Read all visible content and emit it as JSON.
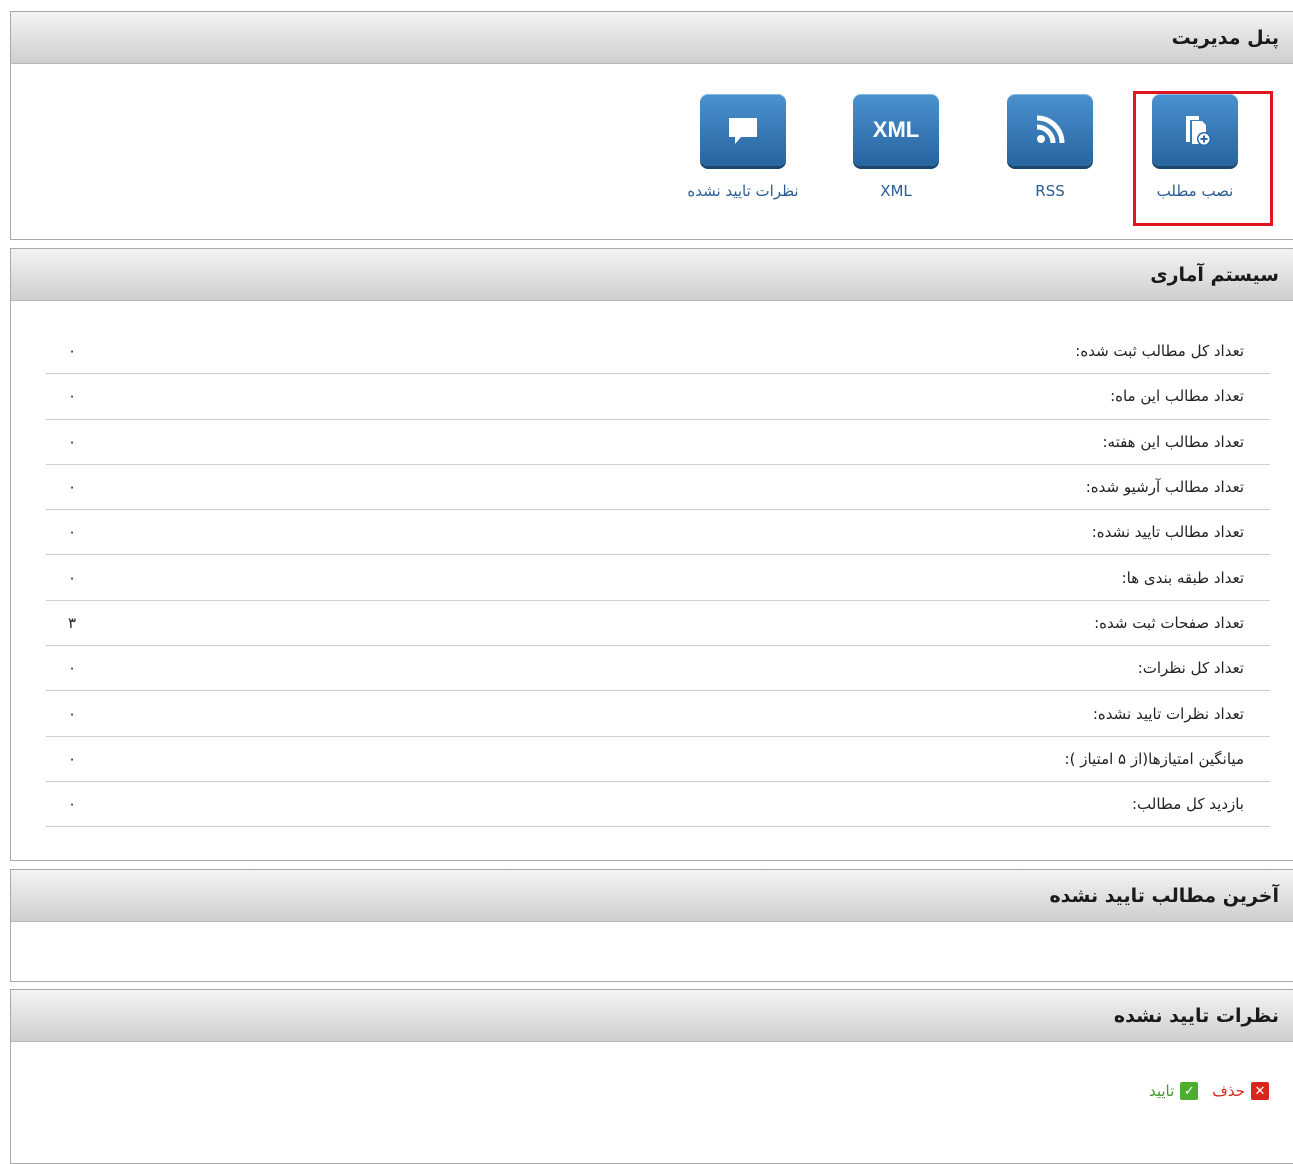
{
  "admin_panel": {
    "title": "پنل مدیریت",
    "shortcuts": [
      {
        "label": "نصب مطلب",
        "icon": "add-document-icon"
      },
      {
        "label": "RSS",
        "icon": "rss-icon"
      },
      {
        "label": "XML",
        "icon": "xml-icon",
        "tile_text": "XML"
      },
      {
        "label": "نظرات تایید نشده",
        "icon": "comment-icon"
      }
    ]
  },
  "stats": {
    "title": "سیستم آماری",
    "rows": [
      {
        "label": "تعداد کل مطالب ثبت شده:",
        "value": "۰"
      },
      {
        "label": "تعداد مطالب این ماه:",
        "value": "۰"
      },
      {
        "label": "تعداد مطالب این هفته:",
        "value": "۰"
      },
      {
        "label": "تعداد مطالب آرشیو شده:",
        "value": "۰"
      },
      {
        "label": "تعداد مطالب تایید نشده:",
        "value": "۰"
      },
      {
        "label": "تعداد طبقه بندی ها:",
        "value": "۰"
      },
      {
        "label": "تعداد صفحات ثبت شده:",
        "value": "۳"
      },
      {
        "label": "تعداد کل نظرات:",
        "value": "۰"
      },
      {
        "label": "تعداد نظرات تایید نشده:",
        "value": "۰"
      },
      {
        "label": "میانگین امتیازها(از ۵ امتیاز ):",
        "value": "۰"
      },
      {
        "label": "بازدید کل مطالب:",
        "value": "۰"
      }
    ]
  },
  "latest_unapproved": {
    "title": "آخرین مطالب تایید نشده"
  },
  "unapproved_comments": {
    "title": "نظرات تایید نشده",
    "delete_label": "حذف",
    "approve_label": "تایید"
  },
  "colors": {
    "tile": "#3576b5",
    "highlight": "#e0151f",
    "link": "#2a5d96",
    "delete": "#d9261c",
    "approve": "#4cae2f"
  }
}
